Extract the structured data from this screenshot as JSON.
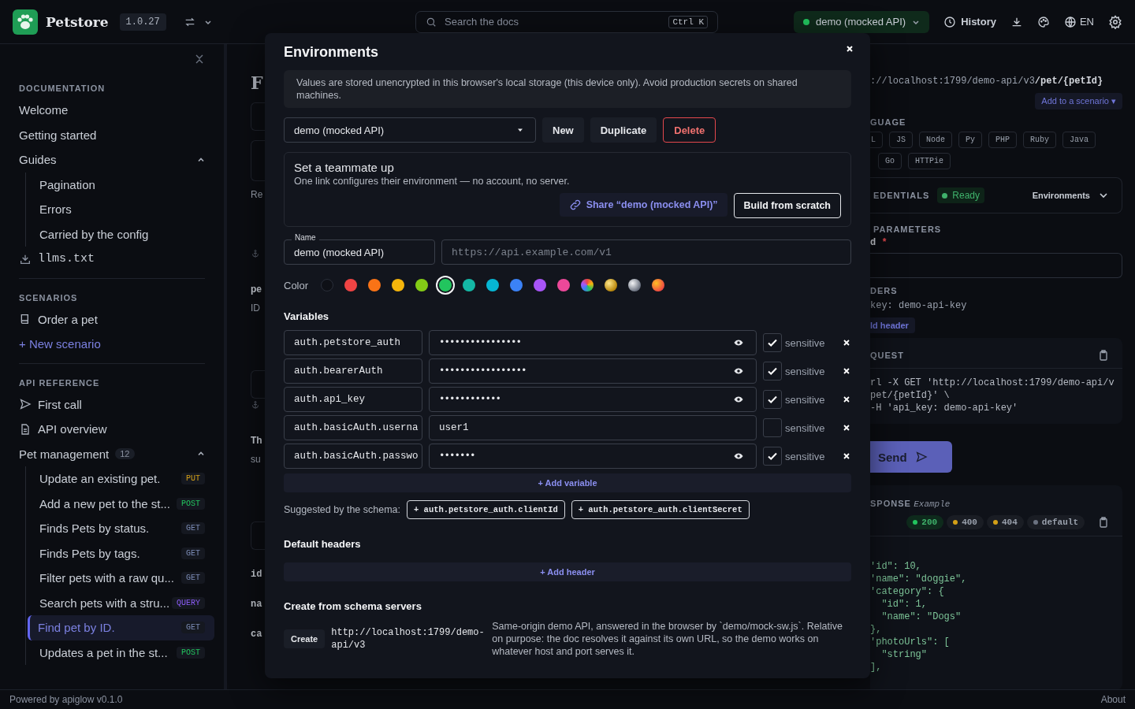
{
  "header": {
    "title": "Petstore",
    "version": "1.0.27",
    "search": {
      "placeholder": "Search the docs",
      "shortcut": "Ctrl K"
    },
    "environment": {
      "label": "demo (mocked API)",
      "color": "#22c55e"
    },
    "history": "History",
    "language": "EN"
  },
  "sidebar": {
    "sections": [
      {
        "title": "DOCUMENTATION",
        "items": [
          {
            "kind": "link",
            "label": "Welcome"
          },
          {
            "kind": "link",
            "label": "Getting started"
          },
          {
            "kind": "group",
            "label": "Guides",
            "expanded": true,
            "children": [
              {
                "label": "Pagination",
                "selected": false
              },
              {
                "label": "Errors",
                "selected": false
              },
              {
                "label": "Carried by the config",
                "selected": false
              }
            ]
          },
          {
            "kind": "download",
            "label": "llms.txt"
          }
        ]
      },
      {
        "title": "SCENARIOS",
        "items": [
          {
            "kind": "scenario",
            "label": "Order a pet"
          },
          {
            "kind": "action",
            "label": "+ New scenario"
          }
        ]
      },
      {
        "title": "API REFERENCE",
        "items": [
          {
            "kind": "guide",
            "label": "First call"
          },
          {
            "kind": "overview",
            "label": "API overview"
          },
          {
            "kind": "group",
            "label": "Pet management",
            "count": "12",
            "expanded": true,
            "children": [
              {
                "label": "Update an existing pet.",
                "method": "PUT",
                "color": "#d4a017",
                "selected": false
              },
              {
                "label": "Add a new pet to the st...",
                "method": "POST",
                "color": "#22c55e",
                "selected": false
              },
              {
                "label": "Finds Pets by status.",
                "method": "GET",
                "color": "#7b8bb5",
                "selected": false
              },
              {
                "label": "Finds Pets by tags.",
                "method": "GET",
                "color": "#7b8bb5",
                "selected": false
              },
              {
                "label": "Filter pets with a raw qu...",
                "method": "GET",
                "color": "#7b8bb5",
                "selected": false
              },
              {
                "label": "Search pets with a stru...",
                "method": "QUERY",
                "color": "#8b5cf6",
                "selected": false
              },
              {
                "label": "Find pet by ID.",
                "method": "GET",
                "color": "#7b8bb5",
                "selected": true
              },
              {
                "label": "Updates a pet in the st...",
                "method": "POST",
                "color": "#22c55e",
                "selected": false
              }
            ]
          }
        ]
      }
    ]
  },
  "middle": {
    "items": [
      {
        "kind": "heading",
        "text": "F"
      },
      {
        "kind": "field"
      },
      {
        "kind": "card"
      },
      {
        "kind": "text",
        "text": "Re"
      },
      {
        "kind": "anchor"
      },
      {
        "kind": "label",
        "text": "pe"
      },
      {
        "kind": "text",
        "text": "ID"
      },
      {
        "kind": "field"
      },
      {
        "kind": "anchor"
      },
      {
        "kind": "label",
        "text": "Th"
      },
      {
        "kind": "text",
        "text": "su"
      },
      {
        "kind": "field"
      },
      {
        "kind": "mono",
        "text": "id"
      },
      {
        "kind": "mono",
        "text": "na"
      },
      {
        "kind": "mono",
        "text": "ca"
      }
    ]
  },
  "modal": {
    "title": "Environments",
    "notice": "Values are stored unencrypted in this browser's local storage (this device only). Avoid production secrets on shared machines.",
    "environment_select": {
      "value": "demo (mocked API)"
    },
    "buttons": [
      {
        "label": "New",
        "kind": "plain"
      },
      {
        "label": "Duplicate",
        "kind": "plain"
      },
      {
        "label": "Delete",
        "kind": "danger"
      }
    ],
    "share_card": {
      "title": "Set a teammate up",
      "description": "One link configures their environment — no account, no server.",
      "share_button": "Share “demo (mocked API)”",
      "build_button": "Build from scratch"
    },
    "name_field": {
      "label": "Name",
      "value": "demo (mocked API)"
    },
    "url_field": {
      "placeholder": "https://api.example.com/v1"
    },
    "color_label": "Color",
    "colors": [
      {
        "kind": "none",
        "selected": false
      },
      {
        "kind": "solid",
        "color": "#ef4444",
        "selected": false
      },
      {
        "kind": "solid",
        "color": "#f97316",
        "selected": false
      },
      {
        "kind": "solid",
        "color": "#f5b50b",
        "selected": false
      },
      {
        "kind": "solid",
        "color": "#84cc16",
        "selected": false
      },
      {
        "kind": "solid",
        "color": "#22c55e",
        "selected": true
      },
      {
        "kind": "solid",
        "color": "#14b8a6",
        "selected": false
      },
      {
        "kind": "solid",
        "color": "#06b6d4",
        "selected": false
      },
      {
        "kind": "solid",
        "color": "#3b82f6",
        "selected": false
      },
      {
        "kind": "solid",
        "color": "#a855f7",
        "selected": false
      },
      {
        "kind": "solid",
        "color": "#ec4899",
        "selected": false
      },
      {
        "kind": "rainbow",
        "selected": false
      },
      {
        "kind": "gold",
        "selected": false
      },
      {
        "kind": "silver",
        "selected": false
      },
      {
        "kind": "sunset",
        "selected": false
      }
    ],
    "variables_title": "Variables",
    "variables": [
      {
        "name": "auth.petstore_auth",
        "value": "••••••••••••••••",
        "masked": true,
        "sensitive": true,
        "sensitive_label": "sensitive"
      },
      {
        "name": "auth.bearerAuth",
        "value": "•••••••••••••••••",
        "masked": true,
        "sensitive": true,
        "sensitive_label": "sensitive"
      },
      {
        "name": "auth.api_key",
        "value": "••••••••••••",
        "masked": true,
        "sensitive": true,
        "sensitive_label": "sensitive"
      },
      {
        "name": "auth.basicAuth.userna",
        "value": "user1",
        "masked": false,
        "sensitive": false,
        "sensitive_label": "sensitive"
      },
      {
        "name": "auth.basicAuth.passwo",
        "value": "•••••••",
        "masked": true,
        "sensitive": true,
        "sensitive_label": "sensitive"
      }
    ],
    "add_variable": "+ Add variable",
    "suggested": {
      "label": "Suggested by the schema:",
      "items": [
        "+ auth.petstore_auth.clientId",
        "+ auth.petstore_auth.clientSecret"
      ]
    },
    "headers_title": "Default headers",
    "add_header": "+ Add header",
    "servers_title": "Create from schema servers",
    "servers": [
      {
        "button": "Create",
        "url": "http://localhost:1799/demo-api/v3",
        "description": "Same-origin demo API, answered in the browser by `demo/mock-sw.js`. Relative on purpose: the doc resolves it against its own URL, so the demo works on whatever host and port serves it."
      }
    ]
  },
  "right": {
    "url_prefix": "://localhost:1799/demo-api/v3",
    "url_path": "/pet/{petId}",
    "add_scenario": "Add to a scenario ▾",
    "language_label": "GUAGE",
    "language_rows": [
      {
        "chips": [
          "L",
          "JS",
          "Node",
          "Py",
          "PHP",
          "Ruby",
          "Java"
        ]
      },
      {
        "chips": [
          "Go",
          "HTTPie"
        ]
      }
    ],
    "credentials": {
      "label": "EDENTIALS",
      "status": "Ready",
      "link": "Environments"
    },
    "parameters_label": "PARAMETERS",
    "param_name": "d",
    "param_required": "*",
    "headers_label": "DERS",
    "header_line": "key: demo-api-key",
    "add_header": "ld header",
    "request": {
      "label": "QUEST",
      "lines": [
        "rl -X GET 'http://localhost:1799/demo-api/v",
        "pet/{petId}' \\",
        "-H 'api_key: demo-api-key'"
      ]
    },
    "send": "Send",
    "response": {
      "label": "SPONSE",
      "tag": "Example",
      "statuses": [
        {
          "label": "200",
          "color": "#22c55e",
          "selected": true
        },
        {
          "label": "400",
          "color": "#d4a017",
          "selected": false
        },
        {
          "label": "404",
          "color": "#d4a017",
          "selected": false
        },
        {
          "label": "default",
          "color": "#6b7280",
          "selected": false
        }
      ],
      "lines": [
        "'id\": 10,",
        "'name\": \"doggie\",",
        "'category\": {",
        "  \"id\": 1,",
        "  \"name\": \"Dogs\"",
        "},",
        "'photoUrls\": [",
        "  \"string\"",
        "],"
      ]
    }
  },
  "footer": {
    "powered": "Powered by apiglow v0.1.0",
    "about": "About"
  }
}
